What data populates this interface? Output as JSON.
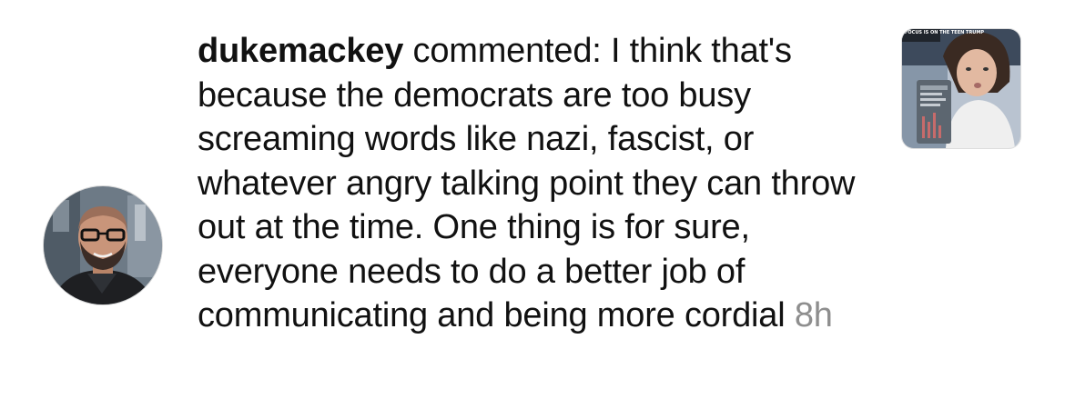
{
  "notification": {
    "username": "dukemackey",
    "action": "commented:",
    "comment": "I think that's because the democrats are too busy screaming words like nazi, fascist, or whatever angry talking point they can throw out at the time. One thing is for sure, everyone needs to do a better job of communicating and being more cordial",
    "time": "8h",
    "avatar_icon": "profile-photo",
    "thumbnail_icon": "post-thumbnail",
    "thumbnail_overlay_text": "FOCUS IS ON THE TEEN TRUMP"
  },
  "colors": {
    "text": "#111111",
    "timestamp": "#8e8e8e",
    "background": "#ffffff"
  }
}
